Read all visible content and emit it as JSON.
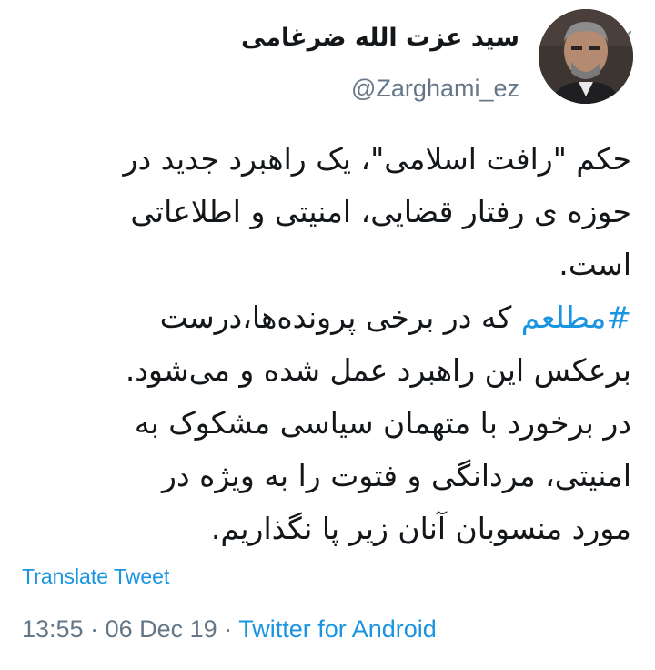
{
  "colors": {
    "accent": "#1b95e0",
    "text": "#14171a",
    "secondary": "#657786"
  },
  "header": {
    "display_name": "سید عزت الله ضرغامی",
    "handle": "@Zarghami_ez",
    "menu_icon": "chevron-down-icon"
  },
  "tweet": {
    "lines": [
      {
        "text": "حکم \"رافت اسلامی\"، یک راهبرد جدید در"
      },
      {
        "text": "حوزه ی رفتار قضایی، امنیتی و اطلاعاتی"
      },
      {
        "text": "است."
      },
      {
        "hashtag": "#مطلعم",
        "text": " که در برخی پرونده‌ها،درست"
      },
      {
        "text": "برعکس  این راهبرد عمل شده و می‌شود."
      },
      {
        "text": " در برخورد با متهمان سیاسی مشکوک به"
      },
      {
        "text": "امنیتی، مردانگی و فتوت را به ویژه در"
      },
      {
        "text": "مورد منسوبان آنان زیر پا نگذاریم."
      }
    ]
  },
  "translate_label": "Translate Tweet",
  "meta": {
    "time": "13:55",
    "separator": " · ",
    "date": "06 Dec 19",
    "source": "Twitter for Android"
  }
}
